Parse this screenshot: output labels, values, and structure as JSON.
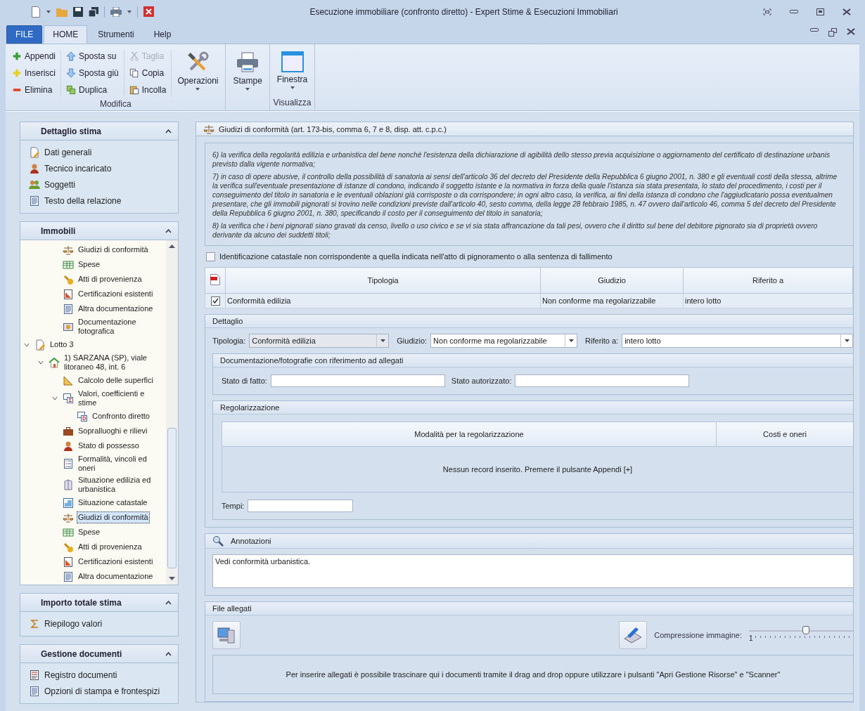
{
  "window": {
    "title": "Esecuzione immobiliare (confronto diretto) - Expert Stime & Esecuzioni Immobiliari"
  },
  "tabs": [
    {
      "label": "FILE",
      "kind": "file",
      "selected": false
    },
    {
      "label": "HOME",
      "kind": "tab",
      "selected": true
    },
    {
      "label": "Strumenti",
      "kind": "tab",
      "selected": false
    },
    {
      "label": "Help",
      "kind": "tab",
      "selected": false
    }
  ],
  "ribbon": {
    "columns": [
      [
        {
          "label": "Appendi",
          "kind": "add",
          "disabled": false
        },
        {
          "label": "Inserisci",
          "kind": "insert",
          "disabled": false
        },
        {
          "label": "Elimina",
          "kind": "remove",
          "disabled": false
        }
      ],
      [
        {
          "label": "Sposta su",
          "kind": "up",
          "disabled": false
        },
        {
          "label": "Sposta giù",
          "kind": "down",
          "disabled": false
        },
        {
          "label": "Duplica",
          "kind": "duplicate",
          "disabled": false
        }
      ],
      [
        {
          "label": "Taglia",
          "kind": "cut",
          "disabled": true
        },
        {
          "label": "Copia",
          "kind": "copy",
          "disabled": false
        },
        {
          "label": "Incolla",
          "kind": "paste",
          "disabled": false
        }
      ]
    ],
    "operations": "Operazioni",
    "group_modifica": "Modifica",
    "print": "Stampe",
    "window_button": "Finestra",
    "group_visualizza": "Visualizza"
  },
  "sidebar": {
    "panels": [
      {
        "title": "Dettaglio stima",
        "expanded": true,
        "items": [
          {
            "label": "Dati generali",
            "kind": "pencildoc"
          },
          {
            "label": "Tecnico incaricato",
            "kind": "person"
          },
          {
            "label": "Soggetti",
            "kind": "people"
          },
          {
            "label": "Testo della relazione",
            "kind": "doc"
          }
        ]
      },
      {
        "title": "Immobili",
        "expanded": true,
        "orphan_items": [
          {
            "label": "Giudizi di conformità",
            "kind": "scales",
            "selected": false
          },
          {
            "label": "Spese",
            "kind": "table",
            "selected": false
          },
          {
            "label": "Atti di provenienza",
            "kind": "stamp",
            "selected": false
          },
          {
            "label": "Certificazioni esistenti",
            "kind": "chart",
            "selected": false
          },
          {
            "label": "Altra documentazione",
            "kind": "doc",
            "selected": false
          },
          {
            "label": "Documentazione fotografica",
            "kind": "photo",
            "selected": false
          }
        ],
        "tree": [
          {
            "label": "Lotto 3",
            "kind": "pencildoc",
            "selected": false,
            "expanded": true,
            "children": [
              {
                "label": "1) SARZANA (SP), viale litoraneo 48, int. 6",
                "kind": "house",
                "selected": false,
                "expanded": true,
                "children": [
                  {
                    "label": "Calcolo delle superfici",
                    "kind": "ruler",
                    "selected": false
                  },
                  {
                    "label": "Valori, coefficienti e stime",
                    "kind": "sigma",
                    "selected": false,
                    "expanded": true,
                    "children": [
                      {
                        "label": "Confronto diretto",
                        "kind": "dtable",
                        "selected": false
                      }
                    ]
                  },
                  {
                    "label": "Sopralluoghi e rilievi",
                    "kind": "briefcase",
                    "selected": false
                  },
                  {
                    "label": "Stato di possesso",
                    "kind": "person",
                    "selected": false
                  },
                  {
                    "label": "Formalità, vincoli ed oneri",
                    "kind": "list",
                    "selected": false
                  },
                  {
                    "label": "Situazione edilizia ed urbanistica",
                    "kind": "building",
                    "selected": false
                  },
                  {
                    "label": "Situazione catastale",
                    "kind": "plan",
                    "selected": false
                  },
                  {
                    "label": "Giudizi di conformità",
                    "kind": "scales",
                    "selected": true
                  },
                  {
                    "label": "Spese",
                    "kind": "table",
                    "selected": false
                  },
                  {
                    "label": "Atti di provenienza",
                    "kind": "stamp",
                    "selected": false
                  },
                  {
                    "label": "Certificazioni esistenti",
                    "kind": "chart",
                    "selected": false
                  },
                  {
                    "label": "Altra documentazione",
                    "kind": "doc",
                    "selected": false
                  }
                ]
              }
            ]
          }
        ]
      },
      {
        "title": "Importo totale stima",
        "expanded": true,
        "items": [
          {
            "label": "Riepilogo valori",
            "kind": "sum"
          }
        ]
      },
      {
        "title": "Gestione documenti",
        "expanded": true,
        "items": [
          {
            "label": "Registro documenti",
            "kind": "register"
          },
          {
            "label": "Opzioni di stampa e frontespizi",
            "kind": "doc"
          }
        ]
      }
    ]
  },
  "main": {
    "title": "Giudizi di conformità (art. 173-bis, comma 6, 7 e 8, disp. att. c.p.c.)",
    "paragraphs": [
      [
        "6) la verifica della regolarità edilizia e urbanistica del bene nonché l'esistenza della dichiarazione di agibilità dello stesso previa acquisizione o aggiornamento del certificato di destinazione urbanis",
        "previsto dalla vigente normativa;"
      ],
      [
        "7) in caso di opere abusive, il controllo della possibilità di sanatoria ai sensi dell'articolo 36 del decreto del Presidente della Repubblica 6 giugno 2001, n. 380 e gli eventuali costi della stessa, altrime",
        "la verifica sull'eventuale presentazione di istanze di condono, indicando il soggetto istante e la normativa in forza della quale l'istanza sia stata presentata, lo stato del procedimento, i costi per il",
        "conseguimento del titolo in sanatoria e le eventuali oblazioni già corrisposte o da corrispondere; in ogni altro caso, la verifica, ai fini della istanza di condono che l'aggiudicatario possa eventualmen",
        "presentare, che gli immobili pignorati si trovino nelle condizioni previste dall'articolo 40, sesto comma, della legge 28 febbraio 1985, n. 47 ovvero dall'articolo 46, comma 5 del decreto del Presidente",
        "della Repubblica 6 giugno 2001, n. 380, specificando il costo per il conseguimento del titolo in sanatoria;"
      ],
      [
        "8) la verifica che i beni pignorati siano gravati da censo, livello o uso civico e se vi sia stata affrancazione da tali pesi, ovvero che il diritto sul bene del debitore pignorato sia di proprietà ovvero",
        "derivante da alcuno dei suddetti titoli;"
      ]
    ],
    "mismatch": {
      "label": "Identificazione catastale non corrispondente a quella indicata nell'atto di pignoramento o alla sentenza di fallimento",
      "checked": false
    },
    "table": {
      "columns": [
        "Tipologia",
        "Giudizio",
        "Riferito a"
      ],
      "rows": [
        {
          "checked": true,
          "cells": [
            "Conformità edilizia",
            "Non conforme ma regolarizzabile",
            "intero lotto"
          ]
        }
      ]
    },
    "detail": {
      "title": "Dettaglio",
      "fields": [
        {
          "label": "Tipologia:",
          "value": "Conformità edilizia",
          "disabled": true
        },
        {
          "label": "Giudizio:",
          "value": "Non conforme ma regolarizzabile",
          "disabled": false
        },
        {
          "label": "Riferito a:",
          "value": "intero lotto",
          "disabled": false
        }
      ],
      "docs": {
        "title": "Documentazione/fotografie con riferimento ad allegati",
        "fields": [
          {
            "label": "Stato di fatto:"
          },
          {
            "label": "Stato autorizzato:"
          }
        ]
      },
      "regularization": {
        "title": "Regolarizzazione",
        "columns": [
          "Modalità per la regolarizzazione",
          "Costi e oneri"
        ],
        "empty": "Nessun record inserito. Premere il pulsante Appendi [+]"
      },
      "times": {
        "label": "Tempi:"
      }
    },
    "notes": {
      "title": "Annotazioni",
      "value": "Vedi conformità urbanistica."
    },
    "files": {
      "title": "File allegati",
      "compression": "Compressione immagine:",
      "compression_min": "1",
      "level": 0.54,
      "hint": "Per inserire allegati è possibile trascinare qui i documenti tramite il drag and drop oppure utilizzare i pulsanti \"Apri Gestione Risorse\" e \"Scanner\""
    }
  }
}
